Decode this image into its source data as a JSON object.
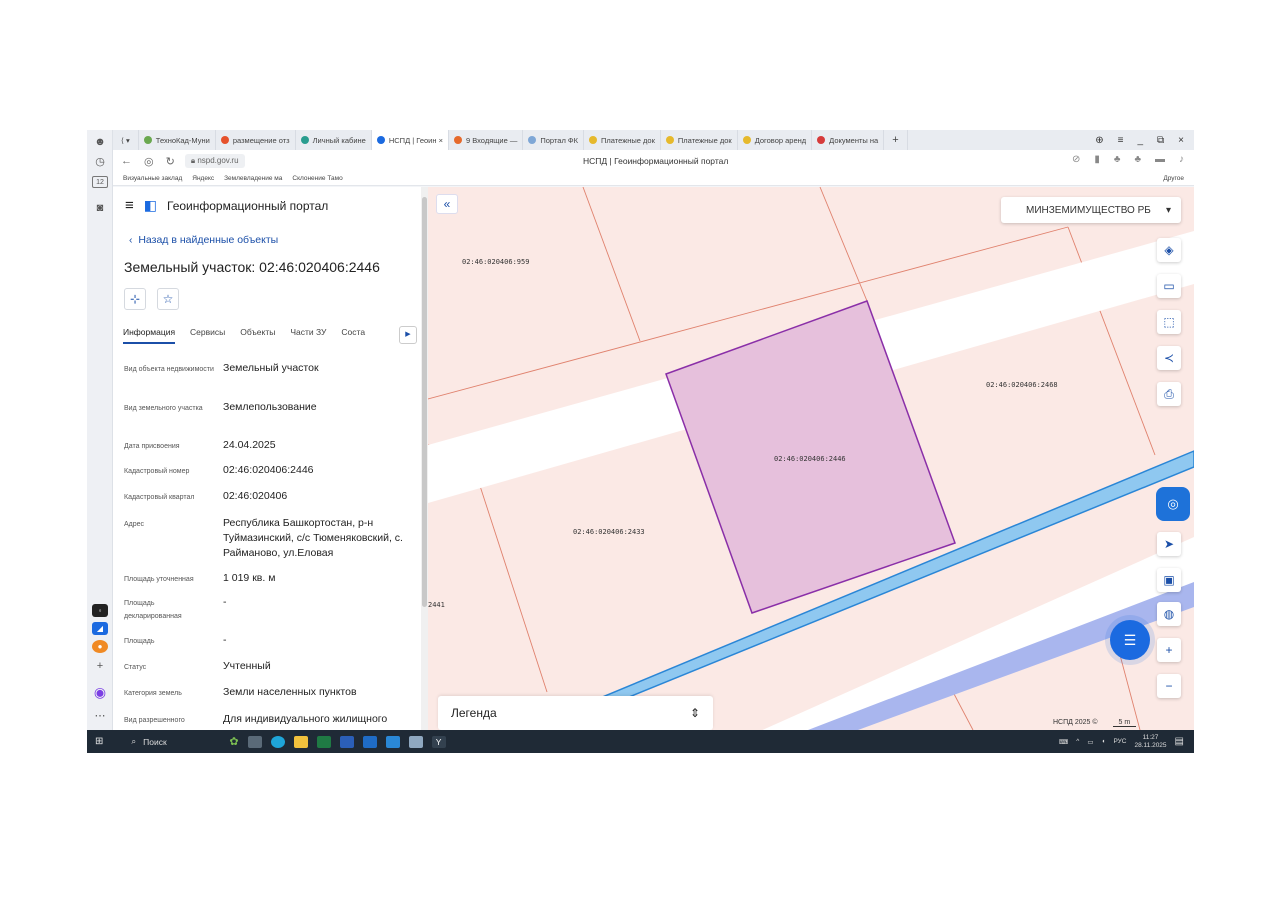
{
  "browser": {
    "tabs": [
      {
        "label": "ТехноКад-Муни",
        "color": "#6aa84f"
      },
      {
        "label": "размещение отз",
        "color": "#e6522c"
      },
      {
        "label": "Личный кабине",
        "color": "#2a9d8f"
      },
      {
        "label": "НСПД | Геоин ×",
        "color": "#1b6ae0",
        "active": true
      },
      {
        "label": "9 Входящие —",
        "color": "#e66a2c"
      },
      {
        "label": "Портал ФК",
        "color": "#7fa7d6"
      },
      {
        "label": "Платежные док",
        "color": "#e6b92c"
      },
      {
        "label": "Платежные док",
        "color": "#e6b92c"
      },
      {
        "label": "Договор аренд",
        "color": "#e6b92c"
      },
      {
        "label": "Документы на",
        "color": "#d63b3b"
      }
    ],
    "url": "nspd.gov.ru",
    "page_title": "НСПД | Геоинформационный портал",
    "bookmarks": [
      "Визуальные заклад",
      "Яндекс",
      "Землевладение ма",
      "Склонение Тамо"
    ],
    "bookmarks_other": "Другое"
  },
  "panel": {
    "portal_title": "Геоинформационный портал",
    "back_link": "Назад в найденные объекты",
    "object_title": "Земельный участок: 02:46:020406:2446",
    "tabs": [
      "Информация",
      "Сервисы",
      "Объекты",
      "Части ЗУ",
      "Соста"
    ],
    "rows": [
      {
        "label": "Вид объекта недвижимости",
        "value": "Земельный участок"
      },
      {
        "label": "Вид земельного участка",
        "value": "Землепользование"
      },
      {
        "label": "Дата присвоения",
        "value": "24.04.2025"
      },
      {
        "label": "Кадастровый номер",
        "value": "02:46:020406:2446"
      },
      {
        "label": "Кадастровый квартал",
        "value": "02:46:020406"
      },
      {
        "label": "Адрес",
        "value": "Республика Башкортостан, р-н Туймазинский, с/с Тюменяковский, с. Райманово, ул.Еловая"
      },
      {
        "label": "Площадь уточненная",
        "value": "1 019 кв. м"
      },
      {
        "label": "Площадь декларированная",
        "value": "-"
      },
      {
        "label": "Площадь",
        "value": "-"
      },
      {
        "label": "Статус",
        "value": "Учтенный"
      },
      {
        "label": "Категория земель",
        "value": "Земли населенных пунктов"
      },
      {
        "label": "Вид разрешенного",
        "value": "Для индивидуального жилищного"
      }
    ]
  },
  "map": {
    "layer_select": "МИНЗЕМИМУЩЕСТВО РБ",
    "legend": "Легенда",
    "parcels": [
      {
        "id": "02:46:020406:959"
      },
      {
        "id": "02:46:020406:2468"
      },
      {
        "id": "02:46:020406:2446"
      },
      {
        "id": "02:46:020406:2433"
      },
      {
        "id": "2441"
      }
    ],
    "scale_left": "НСПД 2025 ©",
    "scale_right": "5 m",
    "selected_fill": "#e6c0dc",
    "road_color": "#8fc8f0"
  },
  "taskbar": {
    "search": "Поиск",
    "lang": "РУС",
    "time": "11:27",
    "date": "28.11.2025"
  }
}
